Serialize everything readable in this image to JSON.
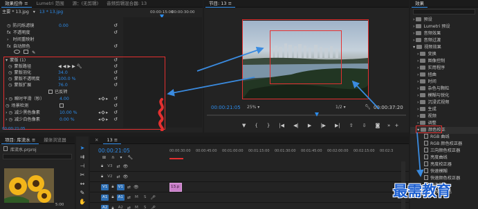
{
  "effect_controls": {
    "tabs": [
      "效果控件 ≡",
      "Lumetri 范围",
      "源：(无剪辑)",
      "音频剪辑混合器: 13"
    ],
    "clip_path": "主要 * 13.jpg",
    "sequence_path": "13 * 13.jpg",
    "ruler_time": "00:00:15:00",
    "ruler_time_end": "00:00:30:00",
    "rows": {
      "flicker_label": "防闪烁滤镜",
      "flicker_value": "0.00",
      "opacity": "不透明度",
      "time_remap": "时间重映射",
      "auto_color": "自动颜色",
      "mask": "蒙版 (1)",
      "mask_path": "蒙版路径",
      "mask_feather": "蒙版羽化",
      "mask_feather_value": "34.0",
      "mask_opacity": "蒙版不透明度",
      "mask_opacity_value": "100.0 %",
      "mask_expansion": "蒙版扩展",
      "mask_expansion_value": "76.0",
      "inverted": "已反转",
      "temporal_smoothing": "瞬时平滑（秒）",
      "temporal_smoothing_value": "4.00",
      "scene_detect": "场景检测",
      "reduce_black": "减少黑色像素",
      "reduce_black_value": "10.00 %",
      "reduce_white": "减少白色像素",
      "reduce_white_value": "0.00 %"
    },
    "footer_time": "00:00:21:05"
  },
  "program_monitor": {
    "title": "节目: 13 ≡",
    "timecode": "00:00:21:05",
    "zoom": "25%",
    "resolution": "1/2",
    "duration": "00:00:37:20"
  },
  "project": {
    "tabs": [
      "项目: 库流水 ≡",
      "媒体浏览器"
    ],
    "bin_name": "库流水.prproj",
    "thumb_duration": "5:00"
  },
  "timeline": {
    "title": "13 ≡",
    "timecode": "00:00:21:05",
    "ruler": [
      "00:00:30:00",
      "00:00:45:00",
      "00:01:00:00",
      "00:01:15:00",
      "00:01:30:00",
      "00:01:45:00",
      "00:02:00:00",
      "00:02:15:00",
      "00:02:3"
    ],
    "tracks": [
      "V3",
      "V2",
      "V1",
      "A1",
      "A2"
    ],
    "clip_label": "13.p"
  },
  "effects_panel": {
    "title": "效果",
    "items": [
      {
        "label": "预设",
        "type": "folder"
      },
      {
        "label": "Lumetri 预设",
        "type": "folder"
      },
      {
        "label": "音频效果",
        "type": "folder"
      },
      {
        "label": "音频过渡",
        "type": "folder"
      },
      {
        "label": "视频效果",
        "type": "folder"
      },
      {
        "label": "变换",
        "type": "folder"
      },
      {
        "label": "图像控制",
        "type": "folder"
      },
      {
        "label": "实用程序",
        "type": "folder"
      },
      {
        "label": "扭曲",
        "type": "folder"
      },
      {
        "label": "时间",
        "type": "folder"
      },
      {
        "label": "杂色与颗粒",
        "type": "folder"
      },
      {
        "label": "模糊与锐化",
        "type": "folder"
      },
      {
        "label": "沉浸式视频",
        "type": "folder"
      },
      {
        "label": "生成",
        "type": "folder"
      },
      {
        "label": "视频",
        "type": "folder"
      },
      {
        "label": "调整",
        "type": "folder"
      },
      {
        "label": "颜色校正",
        "type": "folder"
      },
      {
        "label": "RGB 曲线",
        "type": "effect"
      },
      {
        "label": "RGB 颜色校正器",
        "type": "effect"
      },
      {
        "label": "三向颜色校正器",
        "type": "effect"
      },
      {
        "label": "亮度曲线",
        "type": "effect"
      },
      {
        "label": "亮度校正器",
        "type": "effect"
      },
      {
        "label": "快速模糊",
        "type": "effect"
      },
      {
        "label": "快速颜色校正器",
        "type": "effect"
      },
      {
        "label": "更改颜色",
        "type": "effect"
      },
      {
        "label": "更改为颜色",
        "type": "effect"
      }
    ]
  },
  "watermark": "最需教育",
  "colors": {
    "accent": "#2d8ceb",
    "annotation_red": "#e53030",
    "annotation_blue": "#3a8be0",
    "watermark": "#1d5fd0"
  }
}
